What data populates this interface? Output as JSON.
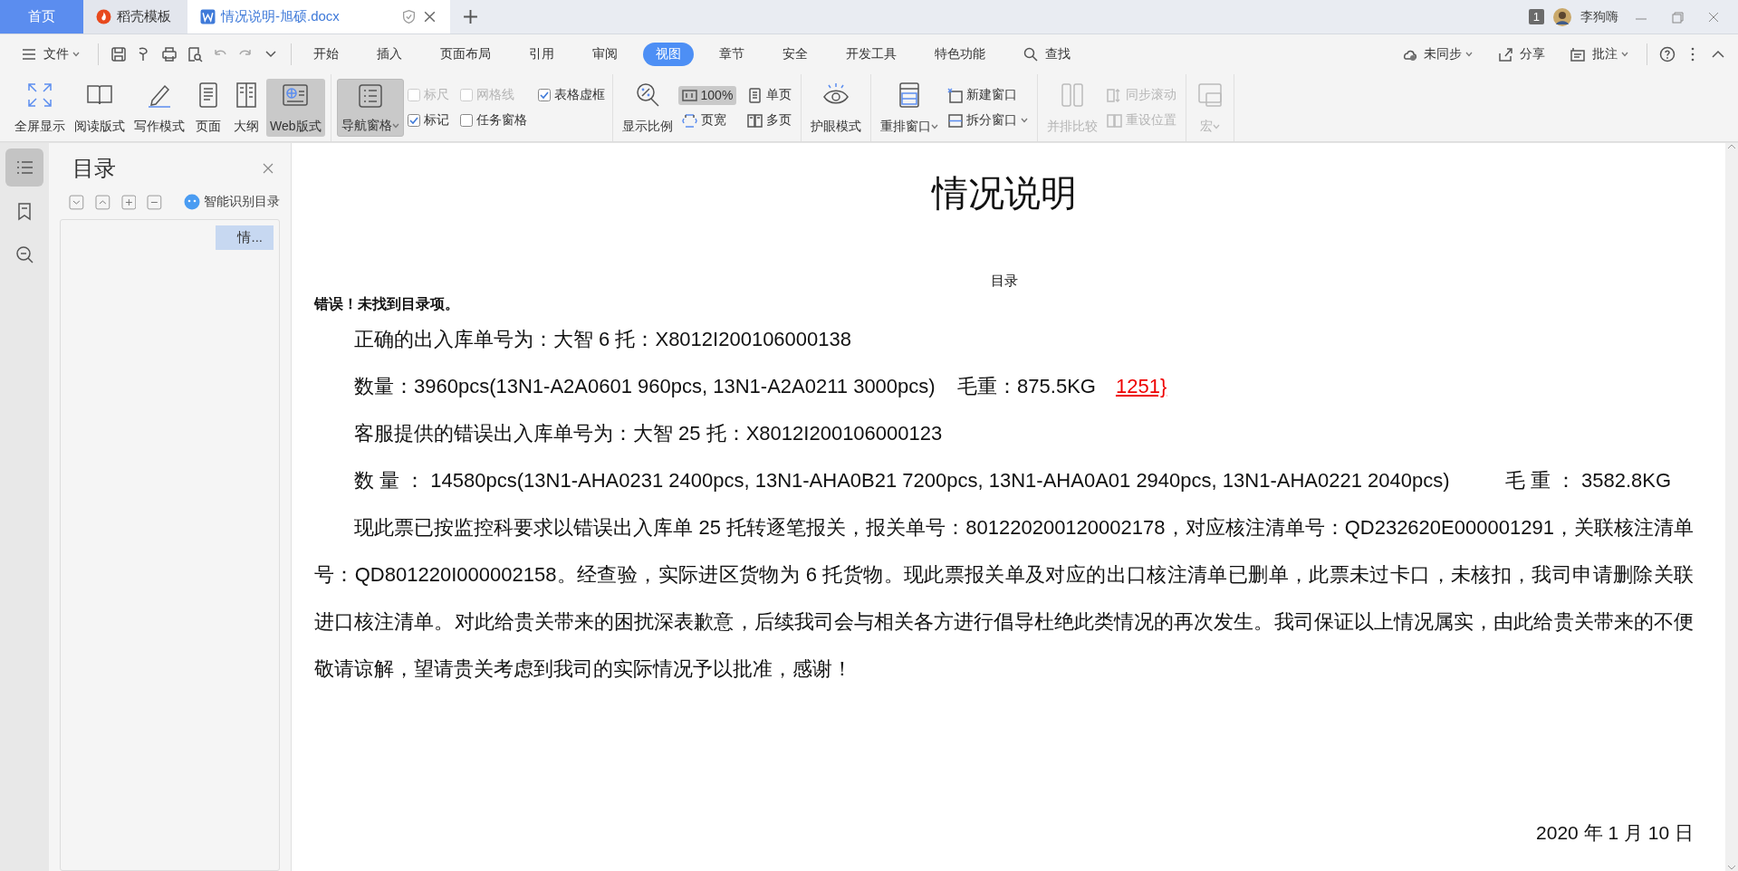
{
  "title_tabs": [
    {
      "label": "首页",
      "kind": "home",
      "selected": false
    },
    {
      "label": "稻壳模板",
      "kind": "template",
      "selected": false
    },
    {
      "label": "情况说明-旭硕.docx",
      "kind": "document",
      "selected": true
    }
  ],
  "account": {
    "badge": "1",
    "user": "李狗嗨"
  },
  "menu": {
    "file": "文件",
    "tabs": [
      {
        "label": "开始",
        "selected": false
      },
      {
        "label": "插入",
        "selected": false
      },
      {
        "label": "页面布局",
        "selected": false
      },
      {
        "label": "引用",
        "selected": false
      },
      {
        "label": "审阅",
        "selected": false
      },
      {
        "label": "视图",
        "selected": true
      },
      {
        "label": "章节",
        "selected": false
      },
      {
        "label": "安全",
        "selected": false
      },
      {
        "label": "开发工具",
        "selected": false
      },
      {
        "label": "特色功能",
        "selected": false
      }
    ],
    "find": "查找",
    "right": [
      {
        "label": "未同步",
        "dropdown": true
      },
      {
        "label": "分享",
        "dropdown": false
      },
      {
        "label": "批注",
        "dropdown": true
      }
    ]
  },
  "ribbon": [
    {
      "items": [
        {
          "kind": "big",
          "label": "全屏显示",
          "selected": false,
          "disabled": false,
          "dropdown": false
        },
        {
          "kind": "big",
          "label": "阅读版式",
          "selected": false,
          "disabled": false,
          "dropdown": false
        },
        {
          "kind": "big",
          "label": "写作模式",
          "selected": false,
          "disabled": false,
          "dropdown": false
        },
        {
          "kind": "big",
          "label": "页面",
          "selected": false,
          "disabled": false,
          "dropdown": false
        },
        {
          "kind": "big",
          "label": "大纲",
          "selected": false,
          "disabled": false,
          "dropdown": false
        },
        {
          "kind": "big",
          "label": "Web版式",
          "selected": true,
          "disabled": false,
          "dropdown": false
        }
      ]
    },
    {
      "items": [
        {
          "kind": "big",
          "label": "导航窗格",
          "selected": true,
          "disabled": false,
          "dropdown": true
        },
        {
          "kind": "check",
          "label": "标尺",
          "checked": false,
          "disabled": true
        },
        {
          "kind": "check",
          "label": "标记",
          "checked": true,
          "disabled": false
        },
        {
          "kind": "check",
          "label": "网格线",
          "checked": false,
          "disabled": true
        },
        {
          "kind": "check",
          "label": "任务窗格",
          "checked": false,
          "disabled": false
        },
        {
          "kind": "check",
          "label": "表格虚框",
          "checked": true,
          "disabled": false
        }
      ]
    },
    {
      "items": [
        {
          "kind": "big",
          "label": "显示比例",
          "selected": false,
          "disabled": false,
          "dropdown": false
        },
        {
          "kind": "small",
          "label": "100%",
          "selected": true,
          "disabled": false,
          "dropdown": false
        },
        {
          "kind": "small",
          "label": "页宽",
          "selected": false,
          "disabled": false,
          "dropdown": false
        },
        {
          "kind": "small",
          "label": "单页",
          "selected": false,
          "disabled": false,
          "dropdown": false
        },
        {
          "kind": "small",
          "label": "多页",
          "selected": false,
          "disabled": false,
          "dropdown": false
        }
      ]
    },
    {
      "items": [
        {
          "kind": "big",
          "label": "护眼模式",
          "selected": false,
          "disabled": false,
          "dropdown": false
        }
      ]
    },
    {
      "items": [
        {
          "kind": "big",
          "label": "重排窗口",
          "selected": false,
          "disabled": false,
          "dropdown": true
        },
        {
          "kind": "small",
          "label": "新建窗口",
          "selected": false,
          "disabled": false,
          "dropdown": false
        },
        {
          "kind": "small",
          "label": "拆分窗口",
          "selected": false,
          "disabled": false,
          "dropdown": true
        }
      ]
    },
    {
      "items": [
        {
          "kind": "big",
          "label": "并排比较",
          "selected": false,
          "disabled": true,
          "dropdown": false
        },
        {
          "kind": "small",
          "label": "同步滚动",
          "selected": false,
          "disabled": true,
          "dropdown": false
        },
        {
          "kind": "small",
          "label": "重设位置",
          "selected": false,
          "disabled": true,
          "dropdown": false
        }
      ]
    },
    {
      "items": [
        {
          "kind": "big",
          "label": "宏",
          "selected": false,
          "disabled": true,
          "dropdown": true
        }
      ]
    }
  ],
  "sidebar": {
    "title": "目录",
    "smart": "智能识别目录",
    "items": [
      {
        "label": "情...",
        "selected": true
      }
    ]
  },
  "document": {
    "title": "情况说明",
    "toc_heading": "目录",
    "toc_error": "错误！未找到目录项。",
    "paragraphs": [
      {
        "text": "正确的出入库单号为：大智 6 托：X8012I200106000138"
      },
      {
        "text": "数量：3960pcs(13N1-A2A0601 960pcs, 13N1-A2A0211 3000pcs)    毛重：875.5KG",
        "revision": "1251}"
      },
      {
        "text": "客服提供的错误出入库单号为：大智 25 托：X8012I200106000123"
      },
      {
        "text": "数 量 ： 14580pcs(13N1-AHA0231 2400pcs, 13N1-AHA0B21 7200pcs, 13N1-AHA0A01 2940pcs, 13N1-AHA0221 2040pcs)          毛 重 ： 3582.8KG"
      },
      {
        "text": "现此票已按监控科要求以错误出入库单 25 托转逐笔报关，报关单号：801220200120002178，对应核注清单号：QD232620E000001291，关联核注清单号：QD801220I000002158。经查验，实际进区货物为 6 托货物。现此票报关单及对应的出口核注清单已删单，此票未过卡口，未核扣，我司申请删除关联进口核注清单。对此给贵关带来的困扰深表歉意，后续我司会与相关各方进行倡导杜绝此类情况的再次发生。我司保证以上情况属实，由此给贵关带来的不便敬请谅解，望请贵关考虑到我司的实际情况予以批准，感谢！"
      }
    ],
    "date": "2020 年 1 月 10 日"
  }
}
